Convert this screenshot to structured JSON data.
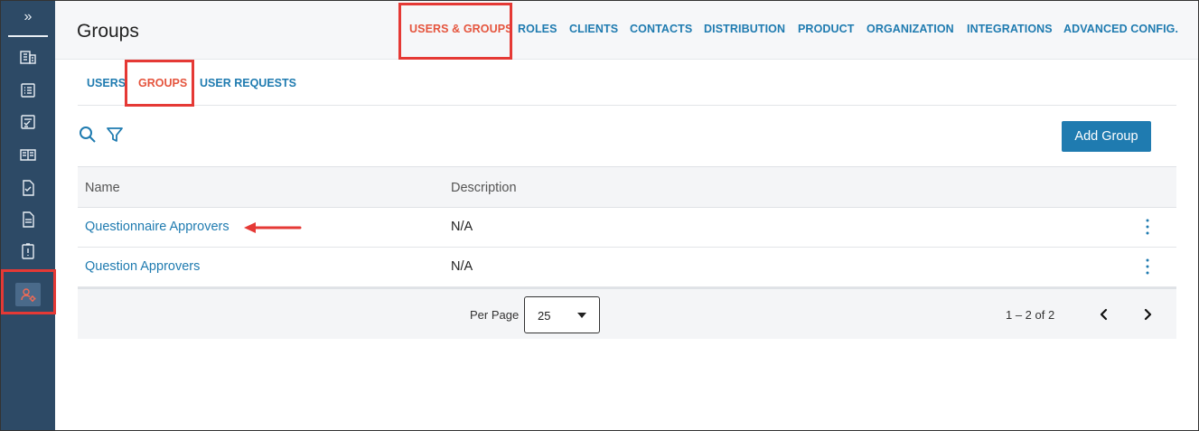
{
  "sidebar": {
    "expand_glyph": "»",
    "items": [
      {
        "icon": "building-icon"
      },
      {
        "icon": "list-icon"
      },
      {
        "icon": "checklist-icon"
      },
      {
        "icon": "book-icon"
      },
      {
        "icon": "document-check-icon"
      },
      {
        "icon": "document-text-icon"
      },
      {
        "icon": "document-alert-icon"
      },
      {
        "icon": "user-gear-icon",
        "active": true
      }
    ]
  },
  "header": {
    "title": "Groups",
    "nav": [
      {
        "label": "USERS & GROUPS",
        "active": true
      },
      {
        "label": "ROLES"
      },
      {
        "label": "CLIENTS"
      },
      {
        "label": "CONTACTS"
      },
      {
        "label": "DISTRIBUTION"
      },
      {
        "label": "PRODUCT"
      },
      {
        "label": "ORGANIZATION"
      },
      {
        "label": "INTEGRATIONS"
      },
      {
        "label": "ADVANCED CONFIG."
      }
    ]
  },
  "subtabs": [
    {
      "label": "USERS"
    },
    {
      "label": "GROUPS",
      "active": true
    },
    {
      "label": "USER REQUESTS"
    }
  ],
  "toolbar": {
    "add_label": "Add Group"
  },
  "table": {
    "columns": [
      "Name",
      "Description"
    ],
    "rows": [
      {
        "name": "Questionnaire Approvers",
        "description": "N/A"
      },
      {
        "name": "Question Approvers",
        "description": "N/A"
      }
    ]
  },
  "pagination": {
    "per_page_label": "Per Page",
    "per_page_value": "25",
    "range": "1 – 2 of 2"
  },
  "colors": {
    "sidebar_bg": "#2d4a66",
    "accent_blue": "#1f7bb0",
    "active_orange": "#e5553e",
    "highlight_red": "#e53935"
  }
}
